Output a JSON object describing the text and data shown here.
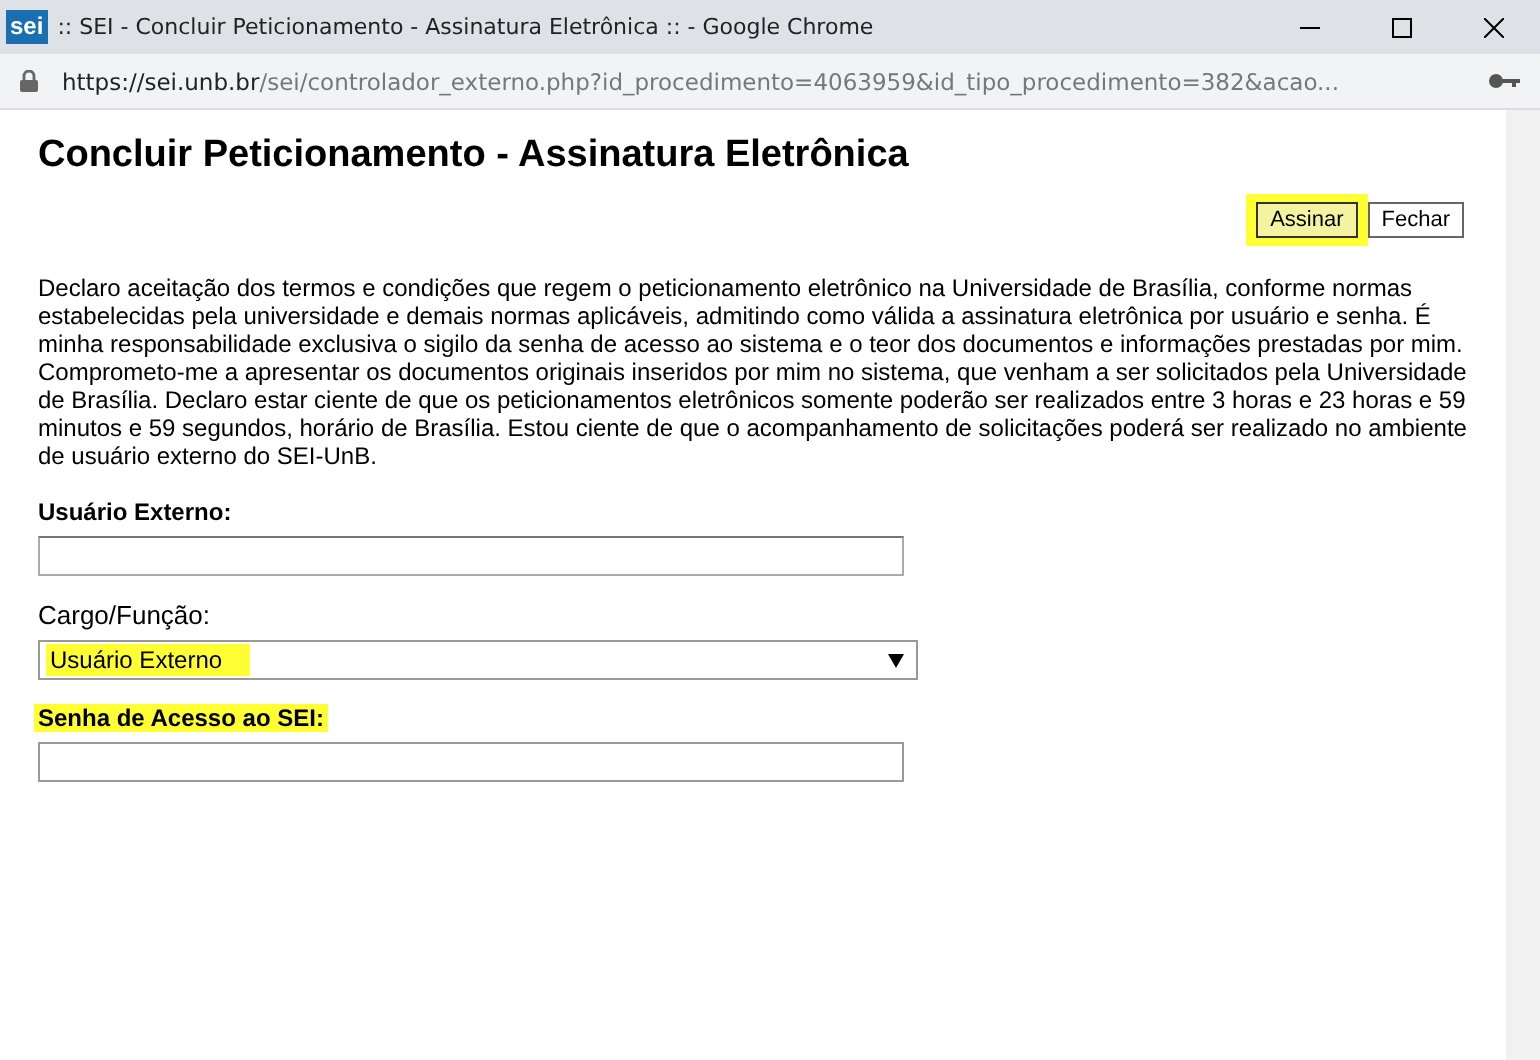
{
  "window": {
    "logo": "sei",
    "title": ":: SEI - Concluir Peticionamento - Assinatura Eletrônica :: - Google Chrome"
  },
  "address_bar": {
    "host": "https://sei.unb.br",
    "path": "/sei/controlador_externo.php?id_procedimento=4063959&id_tipo_procedimento=382&acao..."
  },
  "page": {
    "heading": "Concluir Peticionamento - Assinatura Eletrônica",
    "buttons": [
      {
        "label": "Assinar",
        "highlighted": true
      },
      {
        "label": "Fechar",
        "highlighted": false
      }
    ],
    "declaration": "Declaro aceitação dos termos e condições que regem o peticionamento eletrônico na Universidade de Brasília, conforme normas estabelecidas pela universidade e demais normas aplicáveis, admitindo como válida a assinatura eletrônica por usuário e senha. É minha responsabilidade exclusiva o sigilo da senha de acesso ao sistema e o teor dos documentos e informações prestadas por mim. Comprometo-me a apresentar os documentos originais inseridos por mim no sistema, que venham a ser solicitados pela Universidade de Brasília. Declaro estar ciente de que os peticionamentos eletrônicos somente poderão ser realizados entre 3 horas e 23 horas e 59 minutos e 59 segundos, horário de Brasília. Estou ciente de que o acompanhamento de solicitações poderá ser realizado no ambiente de usuário externo do SEI-UnB.",
    "fields": [
      {
        "kind": "text",
        "label": "Usuário Externo:",
        "highlighted": false
      },
      {
        "kind": "select",
        "label": "Cargo/Função:",
        "value": "Usuário Externo",
        "highlighted": false,
        "value_highlighted": true
      },
      {
        "kind": "password",
        "label": "Senha de Acesso ao SEI:",
        "highlighted": true
      }
    ]
  }
}
